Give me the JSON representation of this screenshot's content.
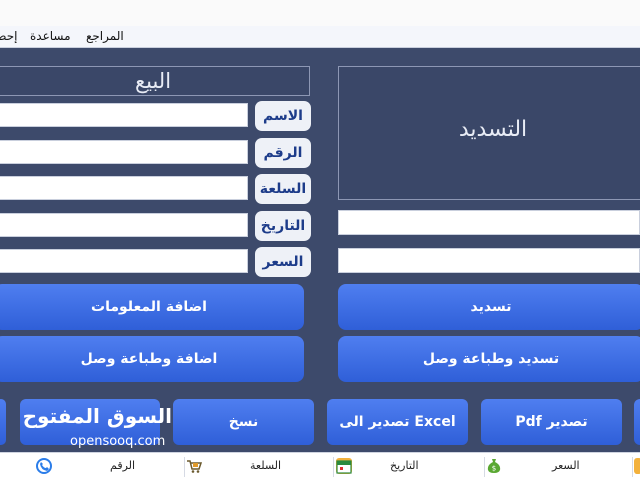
{
  "menu": {
    "items": [
      {
        "label": "المراجع"
      },
      {
        "label": "مساعدة"
      },
      {
        "label": "إحص"
      }
    ]
  },
  "sale": {
    "title": "البيع",
    "fields": [
      {
        "label": "الاسم",
        "value": ""
      },
      {
        "label": "الرقم",
        "value": ""
      },
      {
        "label": "السلعة",
        "value": ""
      },
      {
        "label": "التاريخ",
        "value": ""
      },
      {
        "label": "السعر",
        "value": ""
      }
    ],
    "add_info_label": "اضافة المعلومات",
    "add_print_label": "اضافة وطباعة وصل"
  },
  "payment": {
    "title": "التسديد",
    "field1_value": "",
    "field2_value": "",
    "pay_label": "تسديد",
    "pay_print_label": "تسديد وطباعة وصل"
  },
  "toolbar": {
    "copy_label": "نسخ",
    "export_excel_label": "تصدير الى Excel",
    "export_pdf_label": "Pdf تصدير"
  },
  "statusbar": {
    "items": [
      {
        "label": "الرقم",
        "icon": "phone-icon"
      },
      {
        "label": "السلعة",
        "icon": "cart-icon"
      },
      {
        "label": "التاريخ",
        "icon": "calendar-icon"
      },
      {
        "label": "السعر",
        "icon": "money-bag-icon"
      }
    ]
  },
  "watermark": {
    "text": "السوق المفتوح",
    "subtext": "opensooq.com"
  },
  "colors": {
    "background": "#3d4a6b",
    "button": "#3a6ae6",
    "label_text": "#1d3c8a"
  }
}
